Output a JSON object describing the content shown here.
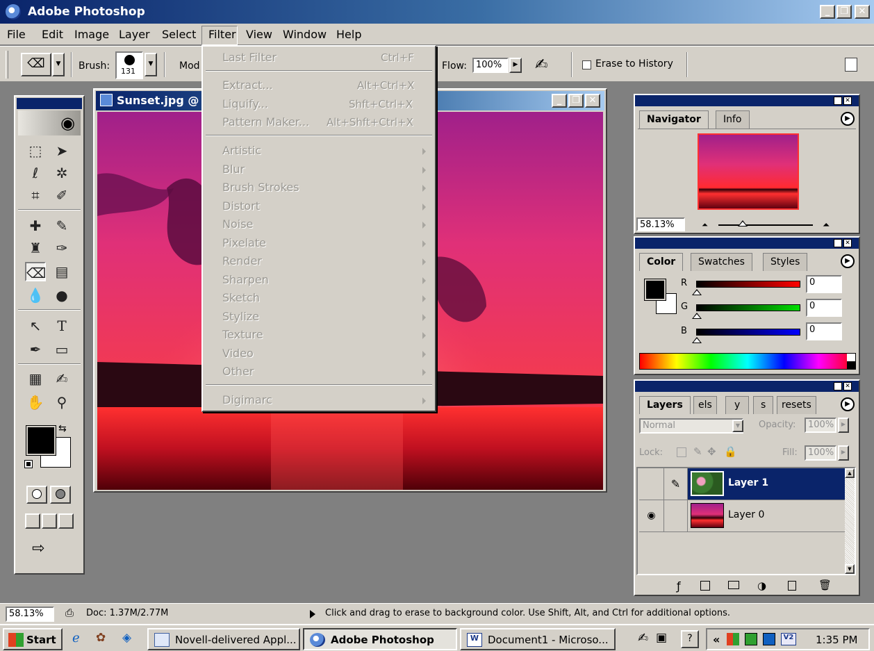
{
  "app": {
    "title": "Adobe Photoshop"
  },
  "window_controls": {
    "minimize": "_",
    "restore": "❐",
    "close": "✕"
  },
  "menu": [
    "File",
    "Edit",
    "Image",
    "Layer",
    "Select",
    "Filter",
    "View",
    "Window",
    "Help"
  ],
  "options_bar": {
    "brush_label": "Brush:",
    "brush_size": "131",
    "mode_label": "Mod",
    "flow_label": "Flow:",
    "flow_value": "100%",
    "erase_to_history_label": "Erase to History"
  },
  "filter_menu": {
    "last_filter": {
      "label": "Last Filter",
      "shortcut": "Ctrl+F"
    },
    "extract": {
      "label": "Extract...",
      "shortcut": "Alt+Ctrl+X"
    },
    "liquify": {
      "label": "Liquify...",
      "shortcut": "Shft+Ctrl+X"
    },
    "pattern_maker": {
      "label": "Pattern Maker...",
      "shortcut": "Alt+Shft+Ctrl+X"
    },
    "submenus": [
      "Artistic",
      "Blur",
      "Brush Strokes",
      "Distort",
      "Noise",
      "Pixelate",
      "Render",
      "Sharpen",
      "Sketch",
      "Stylize",
      "Texture",
      "Video",
      "Other"
    ],
    "digimarc": "Digimarc"
  },
  "document": {
    "title": "Sunset.jpg @"
  },
  "navigator": {
    "tabs": [
      "Navigator",
      "Info"
    ],
    "zoom": "58.13%"
  },
  "color_panel": {
    "tabs": [
      "Color",
      "Swatches",
      "Styles"
    ],
    "r_label": "R",
    "g_label": "G",
    "b_label": "B",
    "r_value": "0",
    "g_value": "0",
    "b_value": "0"
  },
  "layers_panel": {
    "tabs": [
      "Layers",
      "els",
      "y",
      "s",
      "resets"
    ],
    "blend_mode": "Normal",
    "opacity_label": "Opacity:",
    "opacity_value": "100%",
    "lock_label": "Lock:",
    "fill_label": "Fill:",
    "fill_value": "100%",
    "layers": [
      {
        "name": "Layer 1",
        "selected": true,
        "visible": false
      },
      {
        "name": "Layer 0",
        "selected": false,
        "visible": true
      }
    ]
  },
  "status_bar": {
    "zoom": "58.13%",
    "doc": "Doc: 1.37M/2.77M",
    "hint": "Click and drag to erase to background color.  Use Shift, Alt, and Ctrl for additional options."
  },
  "taskbar": {
    "start": "Start",
    "tasks": [
      "Novell-delivered Appl...",
      "Adobe Photoshop",
      "Document1 - Microso..."
    ],
    "tray_chevron": "«",
    "clock": "1:35 PM"
  },
  "colors": {
    "title_blue": "#0a246a",
    "chrome": "#d4d0c8",
    "workspace": "#808080",
    "sunset_pink": "#e8306a"
  }
}
